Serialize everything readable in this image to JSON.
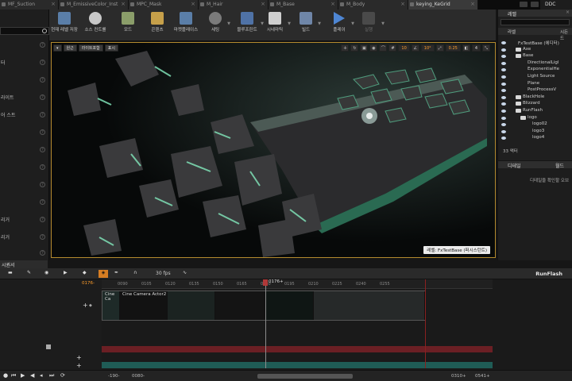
{
  "tabs": [
    {
      "label": "MF_Suction"
    },
    {
      "label": "M_EmissiveColor_Inst"
    },
    {
      "label": "MPC_Mask"
    },
    {
      "label": "M_Hair"
    },
    {
      "label": "M_Base"
    },
    {
      "label": "M_Body"
    },
    {
      "label": "keying_KeGrid"
    }
  ],
  "ddc_label": "DDC",
  "left_panel": {
    "items": [
      "터",
      "라이트",
      "어 스트",
      "리거",
      "리거"
    ]
  },
  "toolbar": {
    "save_label": "현재 레벨 저장",
    "source_label": "소스 컨트롤",
    "mode_label": "모드",
    "content_label": "콘텐츠",
    "market_label": "마켓플레이스",
    "settings_label": "세팅",
    "blueprint_label": "블루프린트",
    "cinematic_label": "시네마틱",
    "build_label": "빌드",
    "play_label": "플레이",
    "launch_label": "실행"
  },
  "viewport": {
    "perspective_label": "원근",
    "lit_label": "라이트포함",
    "show_label": "표시",
    "grid_snap": "10",
    "rot_snap": "10°",
    "scale_snap": "0.25",
    "cam_speed": "4",
    "level_badge": "레벨:  FxTestBase (퍼시스턴트)"
  },
  "outliner": {
    "title": "레벨",
    "col_label": "라벨",
    "col_type": "시든드",
    "rows": [
      {
        "label": "FxTestBase (에디터)",
        "indent": 0,
        "folder": false
      },
      {
        "label": "Axe",
        "indent": 1,
        "folder": true
      },
      {
        "label": "Base",
        "indent": 1,
        "folder": true
      },
      {
        "label": "DirectionalLigl",
        "indent": 2,
        "folder": false
      },
      {
        "label": "ExponentialHe",
        "indent": 2,
        "folder": false
      },
      {
        "label": "Light Source",
        "indent": 2,
        "folder": false
      },
      {
        "label": "Plane",
        "indent": 2,
        "folder": false
      },
      {
        "label": "PostProcessV",
        "indent": 2,
        "folder": false
      },
      {
        "label": "BlackHole",
        "indent": 1,
        "folder": true
      },
      {
        "label": "Blizzard",
        "indent": 1,
        "folder": true
      },
      {
        "label": "RunFlash",
        "indent": 1,
        "folder": true
      },
      {
        "label": "logo",
        "indent": 2,
        "folder": true
      },
      {
        "label": "logo02",
        "indent": 3,
        "folder": false
      },
      {
        "label": "logo3",
        "indent": 3,
        "folder": false
      },
      {
        "label": "logo4",
        "indent": 3,
        "folder": false
      }
    ],
    "count": "33 액터"
  },
  "details": {
    "title": "디테일",
    "tab2": "월드",
    "message": "디테일을 확인할 오브"
  },
  "sequencer": {
    "tab_label": "시퀀서",
    "fps": "30 fps",
    "name": "RunFlash",
    "start_frame": "0176-",
    "playhead_frame": "0176+",
    "ticks": [
      "0090",
      "0105",
      "0120",
      "0135",
      "0150",
      "0165",
      "0180",
      "0195",
      "0210",
      "0225",
      "0240",
      "0255"
    ],
    "shot_labels": [
      "Cine Ca",
      "Cine Camera Actor2"
    ],
    "range_start": "-190-",
    "range_view_start": "0080-",
    "range_view_end": "0310+",
    "range_end": "0541+"
  }
}
